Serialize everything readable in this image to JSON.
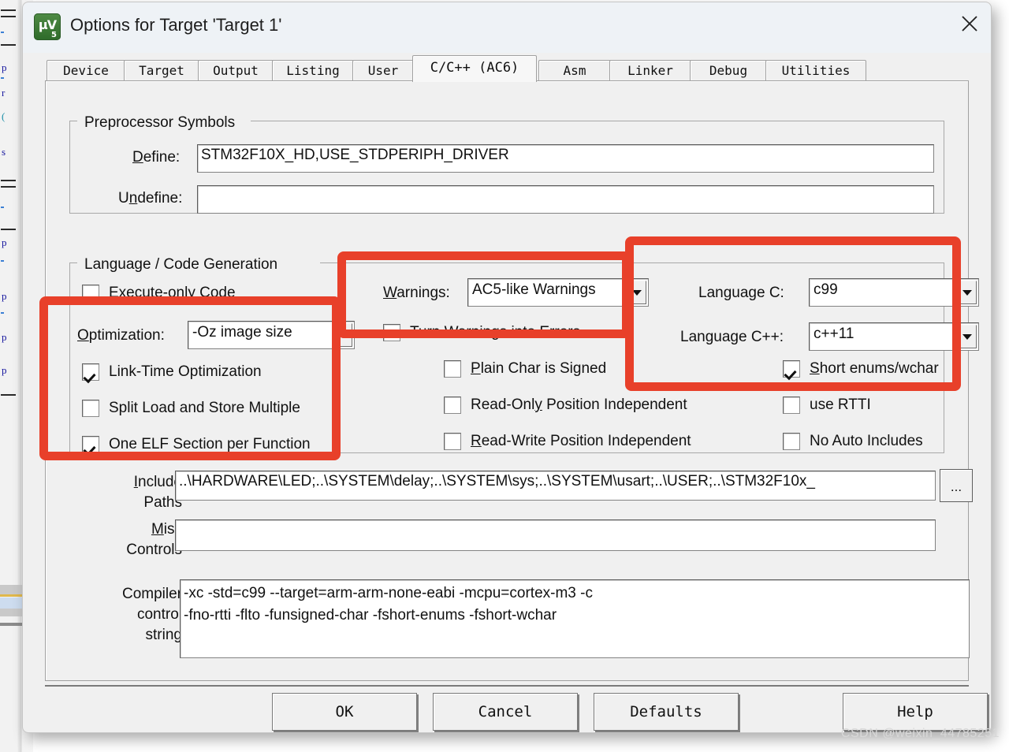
{
  "window": {
    "title": "Options for Target 'Target 1'",
    "icon": "keil-uvision5-icon",
    "close_label": "✕"
  },
  "tabs": [
    {
      "label": "Device",
      "selected": false
    },
    {
      "label": "Target",
      "selected": false
    },
    {
      "label": "Output",
      "selected": false
    },
    {
      "label": "Listing",
      "selected": false
    },
    {
      "label": "User",
      "selected": false
    },
    {
      "label": "C/C++ (AC6)",
      "selected": true
    },
    {
      "label": "Asm",
      "selected": false
    },
    {
      "label": "Linker",
      "selected": false
    },
    {
      "label": "Debug",
      "selected": false
    },
    {
      "label": "Utilities",
      "selected": false
    }
  ],
  "preprocessor": {
    "group_title": "Preprocessor Symbols",
    "define_label": "Define:",
    "define_value": "STM32F10X_HD,USE_STDPERIPH_DRIVER",
    "undefine_label": "Undefine:",
    "undefine_value": ""
  },
  "language": {
    "group_title": "Language / Code Generation",
    "execute_only_label": "Execute-only Code",
    "execute_only_checked": false,
    "optimization_label": "Optimization:",
    "optimization_value": "-Oz image size",
    "link_time_opt_label": "Link-Time Optimization",
    "link_time_opt_checked": true,
    "split_load_label": "Split Load and Store Multiple",
    "split_load_checked": false,
    "one_elf_label": "One ELF Section per Function",
    "one_elf_checked": true,
    "warnings_label": "Warnings:",
    "warnings_value": "AC5-like Warnings",
    "turn_warnings_label": "Turn Warnings into Errors",
    "turn_warnings_checked": false,
    "plain_char_label": "Plain Char is Signed",
    "plain_char_checked": false,
    "read_only_pi_label": "Read-Only Position Independent",
    "read_only_pi_checked": false,
    "read_write_pi_label": "Read-Write Position Independent",
    "read_write_pi_checked": false,
    "language_c_label": "Language C:",
    "language_c_value": "c99",
    "language_cpp_label": "Language C++:",
    "language_cpp_value": "c++11",
    "short_enums_label": "Short enums/wchar",
    "short_enums_checked": true,
    "use_rtti_label": "use RTTI",
    "use_rtti_checked": false,
    "no_auto_includes_label": "No Auto Includes",
    "no_auto_includes_checked": false
  },
  "paths": {
    "include_label_line1": "Include",
    "include_label_line2": "Paths",
    "include_value": "..\\HARDWARE\\LED;..\\SYSTEM\\delay;..\\SYSTEM\\sys;..\\SYSTEM\\usart;..\\USER;..\\STM32F10x_",
    "browse_label": "...",
    "misc_label_line1": "Misc",
    "misc_label_line2": "Controls",
    "misc_value": "",
    "compiler_label_line1": "Compiler",
    "compiler_label_line2": "control",
    "compiler_label_line3": "string",
    "compiler_value": "-xc -std=c99 --target=arm-arm-none-eabi -mcpu=cortex-m3 -c\n-fno-rtti -flto -funsigned-char -fshort-enums -fshort-wchar"
  },
  "footer": {
    "ok": "OK",
    "cancel": "Cancel",
    "defaults": "Defaults",
    "help": "Help"
  },
  "watermark": "CSDN @weixin_44785251",
  "colors": {
    "highlight_red": "#e8402a",
    "dialog_bg": "#f0f0f0",
    "titlebar_bg": "#eef2f6",
    "field_bg": "#ffffff"
  }
}
